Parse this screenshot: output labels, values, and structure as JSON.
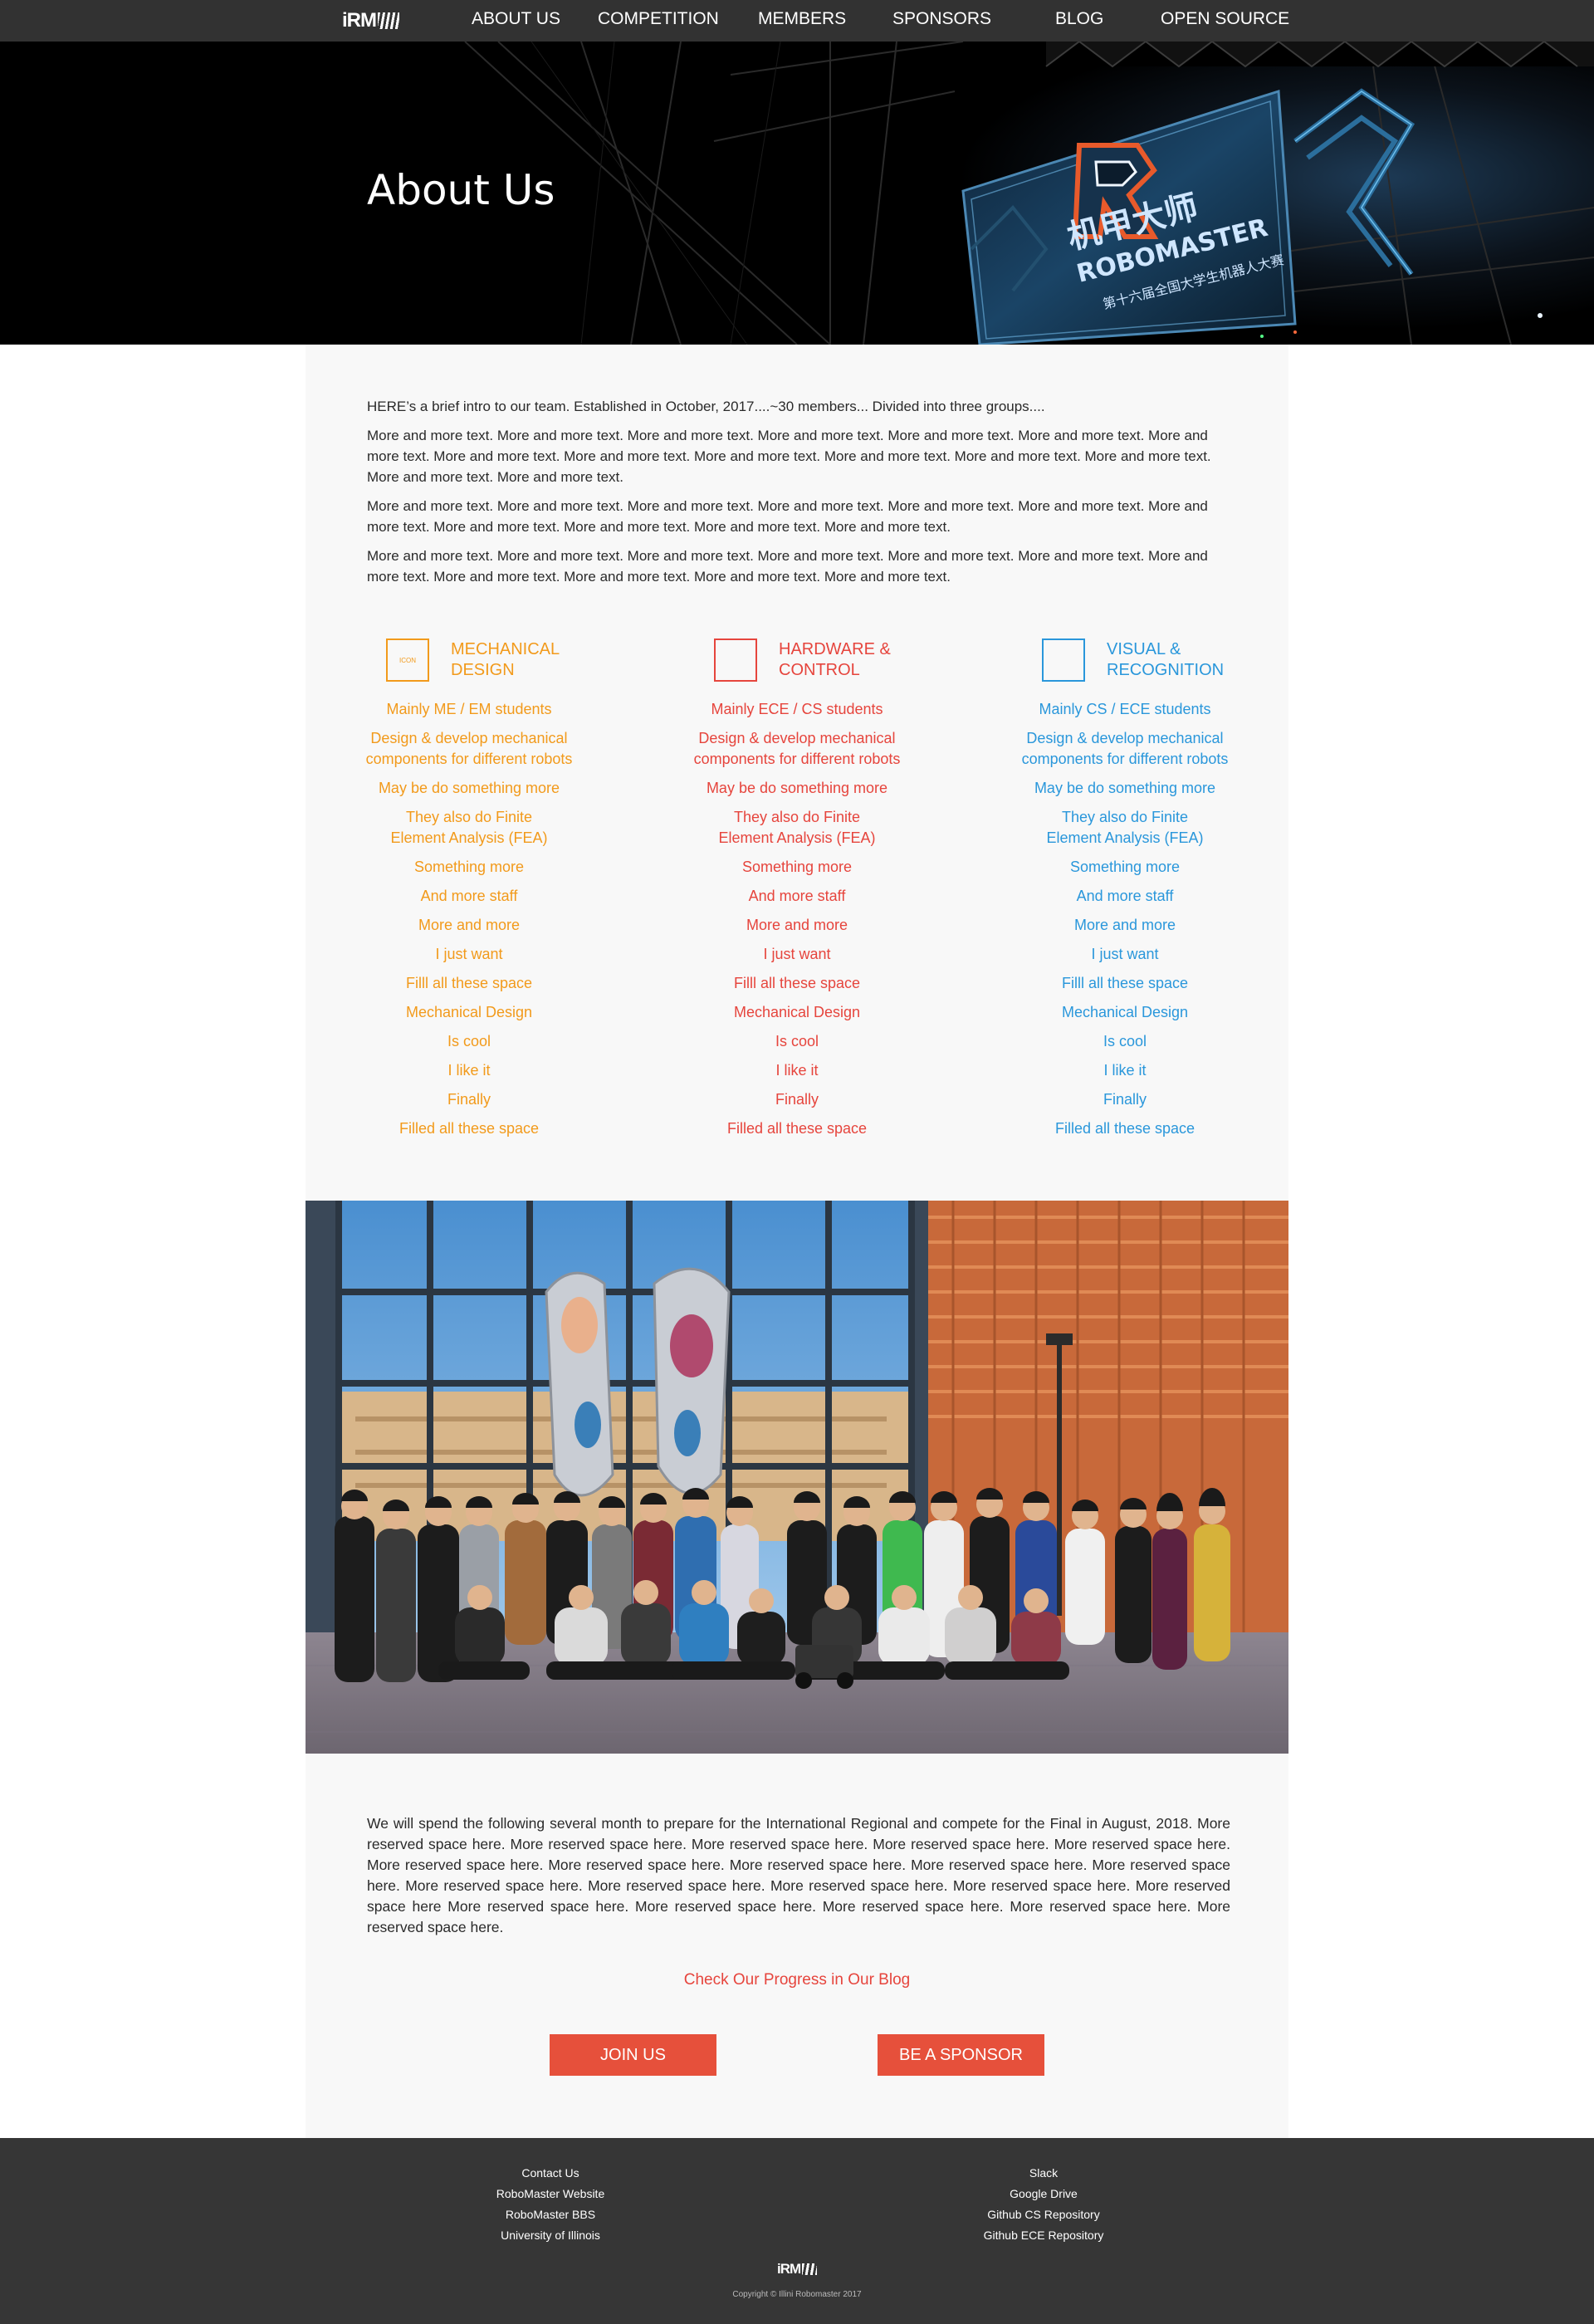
{
  "nav": {
    "logo": "iRM",
    "items": [
      "ABOUT US",
      "COMPETITION",
      "MEMBERS",
      "SPONSORS",
      "BLOG",
      "OPEN SOURCE"
    ]
  },
  "hero": {
    "title": "About Us",
    "banner_brand": "ROBOMASTER",
    "banner_cn_title": "机甲大师",
    "banner_cn_sub": "第十六届全国大学生机器人大赛"
  },
  "intro": {
    "lead": "HERE’s a brief intro to our team. Established in October, 2017....~30 members... Divided into three groups....",
    "p1": "More and more text. More and more text. More and more text. More and more text. More and more text. More and more text. More and more text. More and more text. More and more text. More and more text. More and more text. More and more text. More and more text. More and more text. More and more text.",
    "p2": "More and more text. More and more text. More and more text. More and more text. More and more text. More and more text. More and more text. More and more text. More and more text. More and more text. More and more text.",
    "p3": "More and more text. More and more text. More and more text. More and more text. More and more text. More and more text. More and more text. More and more text. More and more text. More and more text. More and more text."
  },
  "groups": [
    {
      "icon_label": "ICON",
      "title_line1": "MECHANICAL",
      "title_line2": "DESIGN",
      "color": "#f29a1b",
      "items": [
        "Mainly ME / EM students",
        "Design & develop mechanical",
        "components for different robots",
        "May be do something more",
        "They also do Finite",
        "Element Analysis (FEA)",
        "Something more",
        "And more staff",
        "More and more",
        "I just want",
        "Filll all these space",
        "Mechanical Design",
        "Is cool",
        "I like it",
        "Finally",
        "Filled all these space"
      ]
    },
    {
      "icon_label": "",
      "title_line1": "HARDWARE &",
      "title_line2": "CONTROL",
      "color": "#e6453d",
      "items": [
        "Mainly ECE / CS students",
        "Design & develop mechanical",
        "components for different robots",
        "May be do something more",
        "They also do Finite",
        "Element Analysis (FEA)",
        "Something more",
        "And more staff",
        "More and more",
        "I just want",
        "Filll all these space",
        "Mechanical Design",
        "Is cool",
        "I like it",
        "Finally",
        "Filled all these space"
      ]
    },
    {
      "icon_label": "",
      "title_line1": "VISUAL &",
      "title_line2": "RECOGNITION",
      "color": "#2a97db",
      "items": [
        "Mainly CS / ECE students",
        "Design & develop mechanical",
        "components for different robots",
        "May be do something more",
        "They also do Finite",
        "Element Analysis (FEA)",
        "Something more",
        "And more staff",
        "More and more",
        "I just want",
        "Filll all these space",
        "Mechanical Design",
        "Is cool",
        "I like it",
        "Finally",
        "Filled all these space"
      ]
    }
  ],
  "outro": {
    "text": "We will spend the following several month to prepare for the International Regional and compete for the Final in August, 2018. More reserved space here. More reserved space here. More reserved space here. More reserved space here. More reserved space here. More reserved space here. More reserved space here. More reserved space here. More reserved space here. More reserved space here. More reserved space here. More reserved space here. More reserved space here. More reserved space here. More reserved space here More reserved space here. More reserved space here. More reserved space here. More reserved space here. More reserved space here.",
    "blog_link": "Check Our Progress in Our Blog",
    "join_button": "JOIN US",
    "sponsor_button": "BE A SPONSOR"
  },
  "footer": {
    "left_links": [
      "Contact Us",
      "RoboMaster Website",
      "RoboMaster BBS",
      "University of Illinois"
    ],
    "right_links": [
      "Slack",
      "Google Drive",
      "Github CS Repository",
      "Github ECE Repository"
    ],
    "logo": "iRM",
    "copyright": "Copyright © Illini Robomaster 2017"
  }
}
